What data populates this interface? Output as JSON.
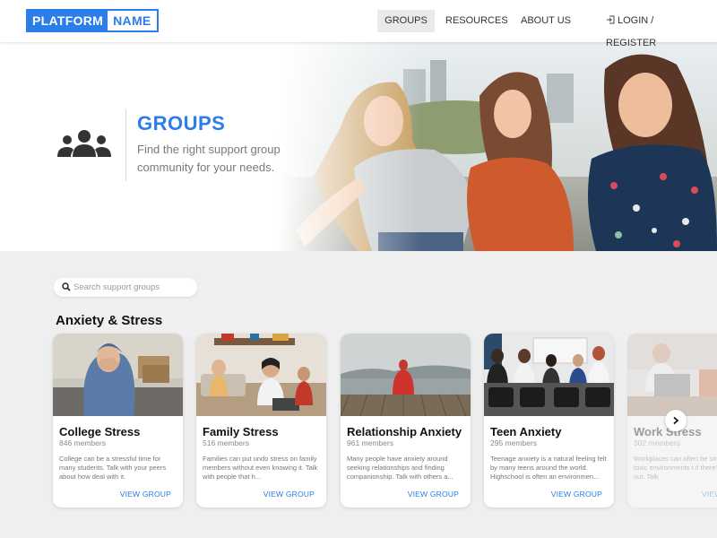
{
  "header": {
    "logo_part1": "PLATFORM",
    "logo_part2": "NAME",
    "nav": {
      "groups": "GROUPS",
      "resources": "RESOURCES",
      "about": "ABOUT US",
      "login": "LOGIN / REGISTER"
    }
  },
  "hero": {
    "title": "GROUPS",
    "subtitle": "Find the right support group community for your needs."
  },
  "search": {
    "placeholder": "Search support groups"
  },
  "section": {
    "title": "Anxiety & Stress"
  },
  "cards": [
    {
      "name": "College Stress",
      "members": "846 members",
      "desc": "College can be a stressful time for many students. Talk with your peers about how deal with it.",
      "cta": "VIEW GROUP"
    },
    {
      "name": "Family Stress",
      "members": "516 members",
      "desc": "Families can put undo stress on family members without even knowing it. Talk with people that h...",
      "cta": "VIEW GROUP"
    },
    {
      "name": "Relationship Anxiety",
      "members": "961 members",
      "desc": "Many people have anxiety around seeking relationships and finding companionship. Talk with others a...",
      "cta": "VIEW GROUP"
    },
    {
      "name": "Teen Anxiety",
      "members": "295 members",
      "desc": "Teenage anxiety is a natural feeling felt by many teens around the world. Highschool is often an environmen...",
      "cta": "VIEW GROUP"
    },
    {
      "name": "Work Stress",
      "members": "302 members",
      "desc": "Workplaces can often be stressful and toxic environments t if there's no way out. Talk",
      "cta": "VIEW"
    }
  ],
  "colors": {
    "accent": "#2b7de9",
    "background": "#efefef"
  },
  "icons": {
    "group": "group-icon",
    "search": "search-icon",
    "login": "login-icon",
    "next": "chevron-right-icon"
  }
}
